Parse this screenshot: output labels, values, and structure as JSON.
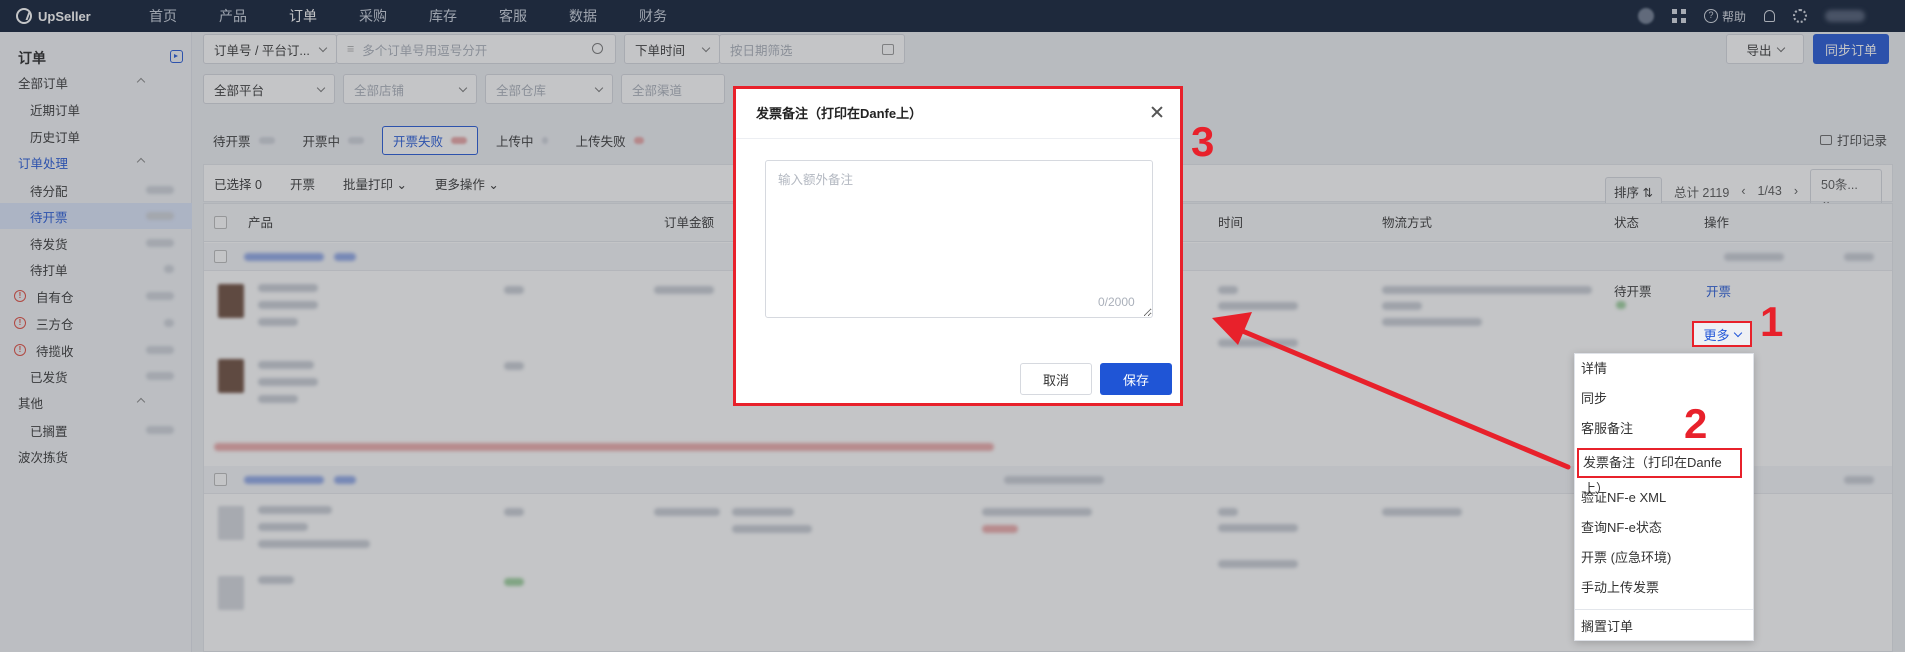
{
  "app": {
    "logo_text": "UpSeller",
    "nav": [
      "首页",
      "产品",
      "订单",
      "采购",
      "库存",
      "客服",
      "数据",
      "财务"
    ],
    "active_nav": "订单",
    "help_label": "帮助"
  },
  "sidebar": {
    "title": "订单",
    "sections": [
      {
        "label": "全部订单",
        "type": "group"
      },
      {
        "label": "近期订单",
        "type": "sub"
      },
      {
        "label": "历史订单",
        "type": "sub"
      },
      {
        "label": "订单处理",
        "type": "group"
      },
      {
        "label": "待分配",
        "type": "sub"
      },
      {
        "label": "待开票",
        "type": "sub"
      },
      {
        "label": "待发货",
        "type": "sub"
      },
      {
        "label": "待打单",
        "type": "sub"
      },
      {
        "label": "自有仓",
        "type": "sub-icon"
      },
      {
        "label": "三方仓",
        "type": "sub-icon"
      },
      {
        "label": "待揽收",
        "type": "sub-icon"
      },
      {
        "label": "已发货",
        "type": "sub"
      },
      {
        "label": "其他",
        "type": "group"
      },
      {
        "label": "已搁置",
        "type": "sub"
      },
      {
        "label": "波次拣货",
        "type": "group"
      }
    ]
  },
  "filters": {
    "order_type": "订单号 / 平台订...",
    "search_placeholder": "多个订单号用逗号分开",
    "time_type": "下单时间",
    "date_placeholder": "按日期筛选",
    "platform": "全部平台",
    "store_placeholder": "全部店铺",
    "warehouse_placeholder": "全部仓库",
    "channel_placeholder": "全部渠道",
    "export_label": "导出",
    "sync_label": "同步订单"
  },
  "status_tabs": [
    "待开票",
    "开票中",
    "开票失败",
    "上传中",
    "上传失败"
  ],
  "active_status_tab": "开票失败",
  "print_record_label": "打印记录",
  "toolbar": {
    "selected": "已选择 0",
    "invoice": "开票",
    "batch_print": "批量打印",
    "more_ops": "更多操作",
    "sort": "排序",
    "total": "总计 2119",
    "page": "1/43",
    "page_size": "50条..."
  },
  "table": {
    "headers": [
      "产品",
      "订单金额",
      "时间",
      "物流方式",
      "状态",
      "操作"
    ],
    "row1": {
      "status": "待开票",
      "action_invoice": "开票"
    }
  },
  "more_button": "更多",
  "menu_items": [
    "详情",
    "同步",
    "客服备注",
    "发票备注（打印在Danfe上）",
    "验证NF-e XML",
    "查询NF-e状态",
    "开票 (应急环境)",
    "手动上传发票",
    "搁置订单"
  ],
  "steps": [
    "1",
    "2",
    "3"
  ],
  "modal": {
    "title": "发票备注（打印在Danfe上）",
    "placeholder": "输入额外备注",
    "value": "",
    "counter": "0/2000",
    "cancel": "取消",
    "save": "保存"
  },
  "colors": {
    "primary": "#1f55d6",
    "highlight_red": "#e8212b",
    "topbar": "#0b1a33"
  }
}
